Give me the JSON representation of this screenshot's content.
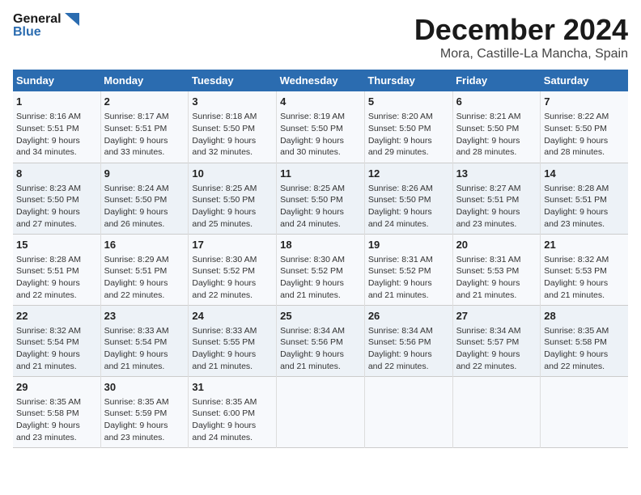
{
  "logo": {
    "line1": "General",
    "line2": "Blue"
  },
  "title": "December 2024",
  "location": "Mora, Castille-La Mancha, Spain",
  "columns": [
    "Sunday",
    "Monday",
    "Tuesday",
    "Wednesday",
    "Thursday",
    "Friday",
    "Saturday"
  ],
  "weeks": [
    [
      {
        "day": "1",
        "info": "Sunrise: 8:16 AM\nSunset: 5:51 PM\nDaylight: 9 hours\nand 34 minutes."
      },
      {
        "day": "2",
        "info": "Sunrise: 8:17 AM\nSunset: 5:51 PM\nDaylight: 9 hours\nand 33 minutes."
      },
      {
        "day": "3",
        "info": "Sunrise: 8:18 AM\nSunset: 5:50 PM\nDaylight: 9 hours\nand 32 minutes."
      },
      {
        "day": "4",
        "info": "Sunrise: 8:19 AM\nSunset: 5:50 PM\nDaylight: 9 hours\nand 30 minutes."
      },
      {
        "day": "5",
        "info": "Sunrise: 8:20 AM\nSunset: 5:50 PM\nDaylight: 9 hours\nand 29 minutes."
      },
      {
        "day": "6",
        "info": "Sunrise: 8:21 AM\nSunset: 5:50 PM\nDaylight: 9 hours\nand 28 minutes."
      },
      {
        "day": "7",
        "info": "Sunrise: 8:22 AM\nSunset: 5:50 PM\nDaylight: 9 hours\nand 28 minutes."
      }
    ],
    [
      {
        "day": "8",
        "info": "Sunrise: 8:23 AM\nSunset: 5:50 PM\nDaylight: 9 hours\nand 27 minutes."
      },
      {
        "day": "9",
        "info": "Sunrise: 8:24 AM\nSunset: 5:50 PM\nDaylight: 9 hours\nand 26 minutes."
      },
      {
        "day": "10",
        "info": "Sunrise: 8:25 AM\nSunset: 5:50 PM\nDaylight: 9 hours\nand 25 minutes."
      },
      {
        "day": "11",
        "info": "Sunrise: 8:25 AM\nSunset: 5:50 PM\nDaylight: 9 hours\nand 24 minutes."
      },
      {
        "day": "12",
        "info": "Sunrise: 8:26 AM\nSunset: 5:50 PM\nDaylight: 9 hours\nand 24 minutes."
      },
      {
        "day": "13",
        "info": "Sunrise: 8:27 AM\nSunset: 5:51 PM\nDaylight: 9 hours\nand 23 minutes."
      },
      {
        "day": "14",
        "info": "Sunrise: 8:28 AM\nSunset: 5:51 PM\nDaylight: 9 hours\nand 23 minutes."
      }
    ],
    [
      {
        "day": "15",
        "info": "Sunrise: 8:28 AM\nSunset: 5:51 PM\nDaylight: 9 hours\nand 22 minutes."
      },
      {
        "day": "16",
        "info": "Sunrise: 8:29 AM\nSunset: 5:51 PM\nDaylight: 9 hours\nand 22 minutes."
      },
      {
        "day": "17",
        "info": "Sunrise: 8:30 AM\nSunset: 5:52 PM\nDaylight: 9 hours\nand 22 minutes."
      },
      {
        "day": "18",
        "info": "Sunrise: 8:30 AM\nSunset: 5:52 PM\nDaylight: 9 hours\nand 21 minutes."
      },
      {
        "day": "19",
        "info": "Sunrise: 8:31 AM\nSunset: 5:52 PM\nDaylight: 9 hours\nand 21 minutes."
      },
      {
        "day": "20",
        "info": "Sunrise: 8:31 AM\nSunset: 5:53 PM\nDaylight: 9 hours\nand 21 minutes."
      },
      {
        "day": "21",
        "info": "Sunrise: 8:32 AM\nSunset: 5:53 PM\nDaylight: 9 hours\nand 21 minutes."
      }
    ],
    [
      {
        "day": "22",
        "info": "Sunrise: 8:32 AM\nSunset: 5:54 PM\nDaylight: 9 hours\nand 21 minutes."
      },
      {
        "day": "23",
        "info": "Sunrise: 8:33 AM\nSunset: 5:54 PM\nDaylight: 9 hours\nand 21 minutes."
      },
      {
        "day": "24",
        "info": "Sunrise: 8:33 AM\nSunset: 5:55 PM\nDaylight: 9 hours\nand 21 minutes."
      },
      {
        "day": "25",
        "info": "Sunrise: 8:34 AM\nSunset: 5:56 PM\nDaylight: 9 hours\nand 21 minutes."
      },
      {
        "day": "26",
        "info": "Sunrise: 8:34 AM\nSunset: 5:56 PM\nDaylight: 9 hours\nand 22 minutes."
      },
      {
        "day": "27",
        "info": "Sunrise: 8:34 AM\nSunset: 5:57 PM\nDaylight: 9 hours\nand 22 minutes."
      },
      {
        "day": "28",
        "info": "Sunrise: 8:35 AM\nSunset: 5:58 PM\nDaylight: 9 hours\nand 22 minutes."
      }
    ],
    [
      {
        "day": "29",
        "info": "Sunrise: 8:35 AM\nSunset: 5:58 PM\nDaylight: 9 hours\nand 23 minutes."
      },
      {
        "day": "30",
        "info": "Sunrise: 8:35 AM\nSunset: 5:59 PM\nDaylight: 9 hours\nand 23 minutes."
      },
      {
        "day": "31",
        "info": "Sunrise: 8:35 AM\nSunset: 6:00 PM\nDaylight: 9 hours\nand 24 minutes."
      },
      {
        "day": "",
        "info": ""
      },
      {
        "day": "",
        "info": ""
      },
      {
        "day": "",
        "info": ""
      },
      {
        "day": "",
        "info": ""
      }
    ]
  ]
}
